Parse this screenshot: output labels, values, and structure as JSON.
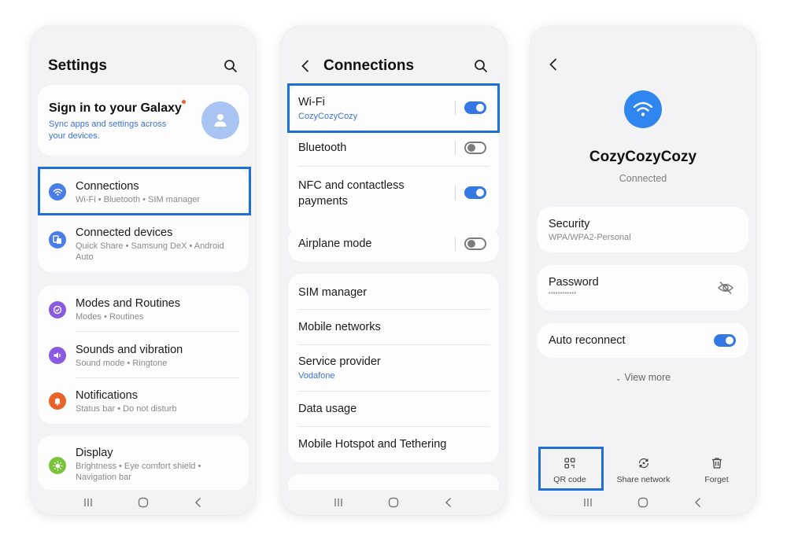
{
  "colors": {
    "accent": "#3478e5",
    "highlight": "#1e6fd9",
    "panel": "#f3f3f5",
    "card": "#fdfdfe"
  },
  "settings": {
    "title": "Settings",
    "galaxy": {
      "title": "Sign in to your Galaxy",
      "subtitle_line1": "Sync apps and settings across",
      "subtitle_line2": "your devices."
    },
    "items": [
      {
        "label": "Connections",
        "sub": "Wi-Fi  •  Bluetooth  •  SIM manager",
        "icon": "wifi-icon",
        "color": "#4a7de8"
      },
      {
        "label": "Connected devices",
        "sub": "Quick Share  •  Samsung DeX  •  Android",
        "sub2": "Auto",
        "icon": "devices-icon",
        "color": "#4a7de8"
      },
      {
        "label": "Modes and Routines",
        "sub": "Modes  •  Routines",
        "icon": "modes-icon",
        "color": "#8a5be0"
      },
      {
        "label": "Sounds and vibration",
        "sub": "Sound mode  •  Ringtone",
        "icon": "volume-icon",
        "color": "#8a5be0"
      },
      {
        "label": "Notifications",
        "sub": "Status bar  •  Do not disturb",
        "icon": "bell-icon",
        "color": "#e8632a"
      },
      {
        "label": "Display",
        "sub": "Brightness  •  Eye comfort shield  •",
        "sub2": "Navigation bar",
        "icon": "sun-icon",
        "color": "#7ac43a"
      }
    ]
  },
  "connections": {
    "title": "Connections",
    "wifi": {
      "label": "Wi-Fi",
      "network": "CozyCozyCozy",
      "on": true
    },
    "bluetooth": {
      "label": "Bluetooth",
      "on": false
    },
    "nfc": {
      "label_line1": "NFC and contactless",
      "label_line2": "payments",
      "on": true
    },
    "airplane": {
      "label": "Airplane mode",
      "on": false
    },
    "list": {
      "sim": "SIM manager",
      "mobile_networks": "Mobile networks",
      "service_provider": "Service provider",
      "provider_name": "Vodafone",
      "data_usage": "Data usage",
      "hotspot": "Mobile Hotspot and Tethering"
    }
  },
  "network": {
    "name": "CozyCozyCozy",
    "status": "Connected",
    "security_label": "Security",
    "security_value": "WPA/WPA2-Personal",
    "password_label": "Password",
    "password_value": "••••••••••••",
    "auto_reconnect": "Auto reconnect",
    "auto_reconnect_on": true,
    "view_more": "View more",
    "actions": {
      "qr": "QR code",
      "share": "Share network",
      "forget": "Forget"
    }
  }
}
